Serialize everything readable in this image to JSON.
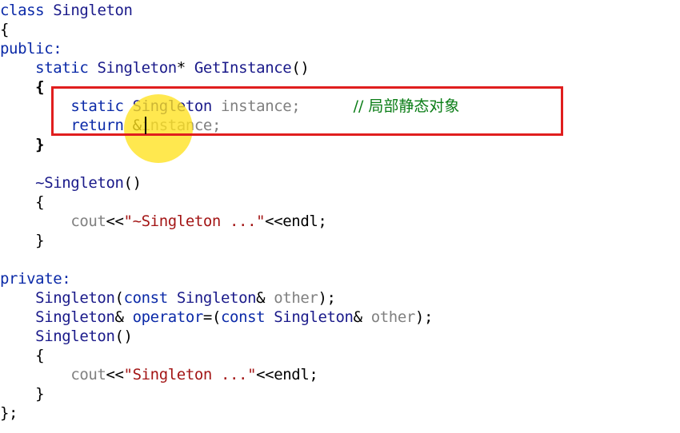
{
  "editor": {
    "lines": {
      "l1": {
        "kw": "class",
        "name": "Singleton"
      },
      "l2": {
        "brace": "{"
      },
      "l3": {
        "kw": "public:"
      },
      "l4": {
        "kw": "static",
        "type": "Singleton",
        "ptr": "*",
        "fn": "GetInstance",
        "parens": "()"
      },
      "l5": {
        "brace": "{"
      },
      "l6": {
        "kw": "static",
        "type": "Singleton",
        "var": "instance;",
        "comment": "// 局部静态对象"
      },
      "l7": {
        "kw": "return",
        "amp": "&",
        "var": "instance;"
      },
      "l8": {
        "brace": "}"
      },
      "l9": {
        "fn": "~Singleton",
        "parens": "()"
      },
      "l10": {
        "brace": "{"
      },
      "l11": {
        "kw1": "cout",
        "op1": "<<",
        "str": "\"~Singleton ...\"",
        "op2": "<<",
        "kw2": "endl",
        "end": ";"
      },
      "l12": {
        "brace": "}"
      },
      "l13": {
        "kw": "private:"
      },
      "l14": {
        "fn": "Singleton",
        "open": "(",
        "kw": "const",
        "type": "Singleton",
        "amp": "&",
        "param": "other",
        "close": ");"
      },
      "l15": {
        "type": "Singleton",
        "amp": "&",
        "kw1": "operator",
        "op": "=(",
        "kw2": "const",
        "type2": "Singleton",
        "amp2": "&",
        "param": "other",
        "close": ");"
      },
      "l16": {
        "fn": "Singleton",
        "parens": "()"
      },
      "l17": {
        "brace": "{"
      },
      "l18": {
        "kw1": "cout",
        "op1": "<<",
        "str": "\"Singleton ...\"",
        "op2": "<<",
        "kw2": "endl",
        "end": ";"
      },
      "l19": {
        "brace": "}"
      },
      "l20": {
        "brace": "};"
      }
    }
  },
  "colors": {
    "keyword": "#0b2aa8",
    "identifier": "#1a1a8a",
    "parameter": "#808080",
    "string": "#a31515",
    "comment": "#0a7d16",
    "highlight_border": "#e01e1e",
    "cursor_spot": "#ffe21e"
  }
}
